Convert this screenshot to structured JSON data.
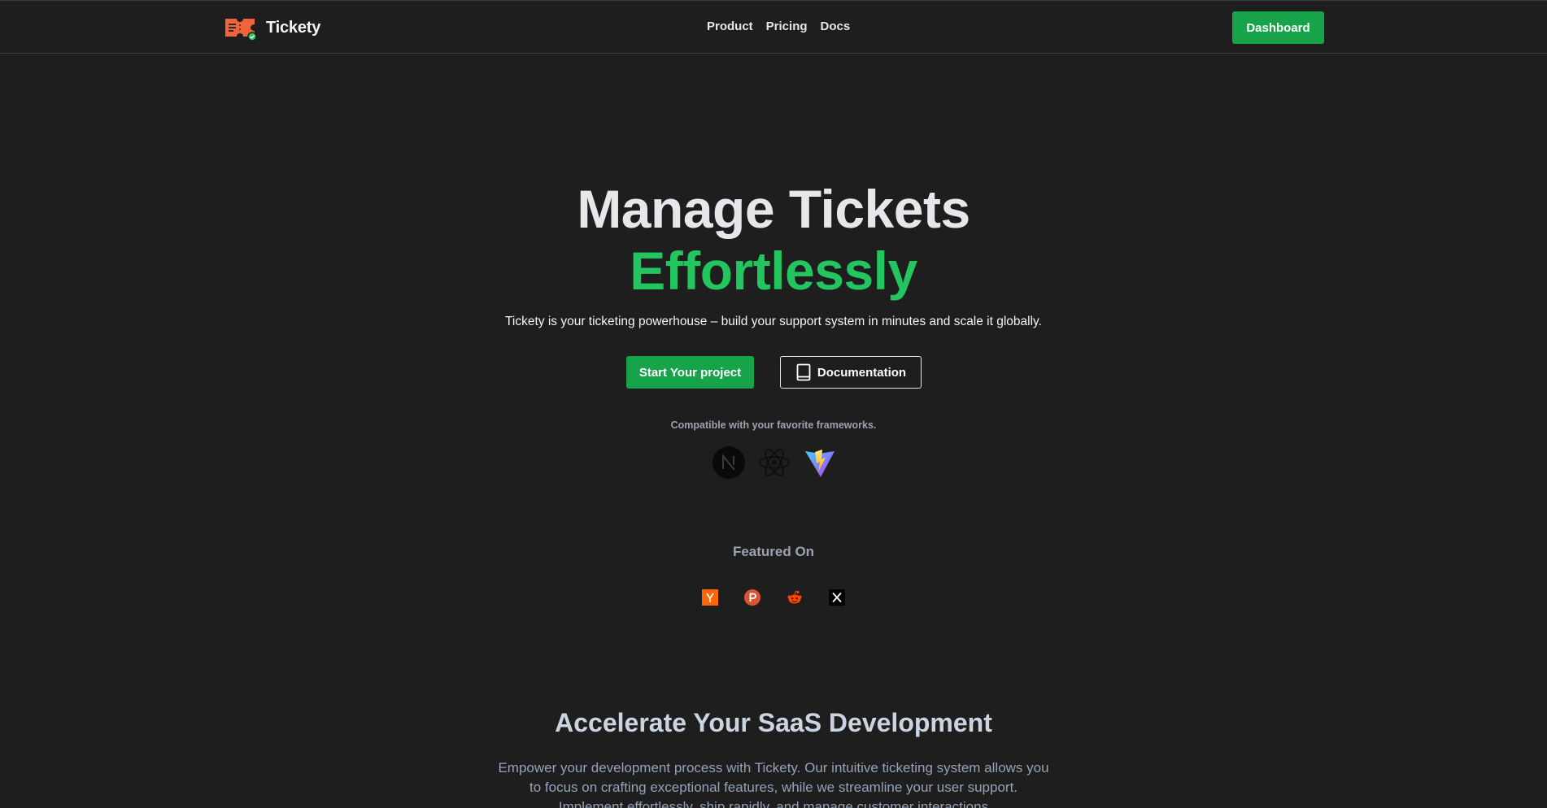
{
  "header": {
    "brand_name": "Tickety",
    "nav": [
      {
        "label": "Product"
      },
      {
        "label": "Pricing"
      },
      {
        "label": "Docs"
      }
    ],
    "dashboard_label": "Dashboard"
  },
  "hero": {
    "title_line1": "Manage Tickets",
    "title_line2": "Effortlessly",
    "subtitle": "Tickety is your ticketing powerhouse – build your support system in minutes and scale it globally.",
    "primary_cta": "Start Your project",
    "secondary_cta": "Documentation",
    "compat_text": "Compatible with your favorite frameworks.",
    "frameworks": [
      {
        "icon": "nextjs-icon"
      },
      {
        "icon": "react-icon"
      },
      {
        "icon": "vite-icon"
      }
    ]
  },
  "featured": {
    "title": "Featured On",
    "icons": [
      "hacker-news-icon",
      "product-hunt-icon",
      "reddit-icon",
      "x-icon"
    ]
  },
  "section": {
    "title": "Accelerate Your SaaS Development",
    "text": "Empower your development process with Tickety. Our intuitive ticketing system allows you to focus on crafting exceptional features, while we streamline your user support. Implement effortlessly, ship rapidly, and manage customer interactions"
  },
  "colors": {
    "background": "#1e1e1e",
    "accent": "#16a34a",
    "accent_text": "#22c55e",
    "logo": "#f0643c"
  }
}
